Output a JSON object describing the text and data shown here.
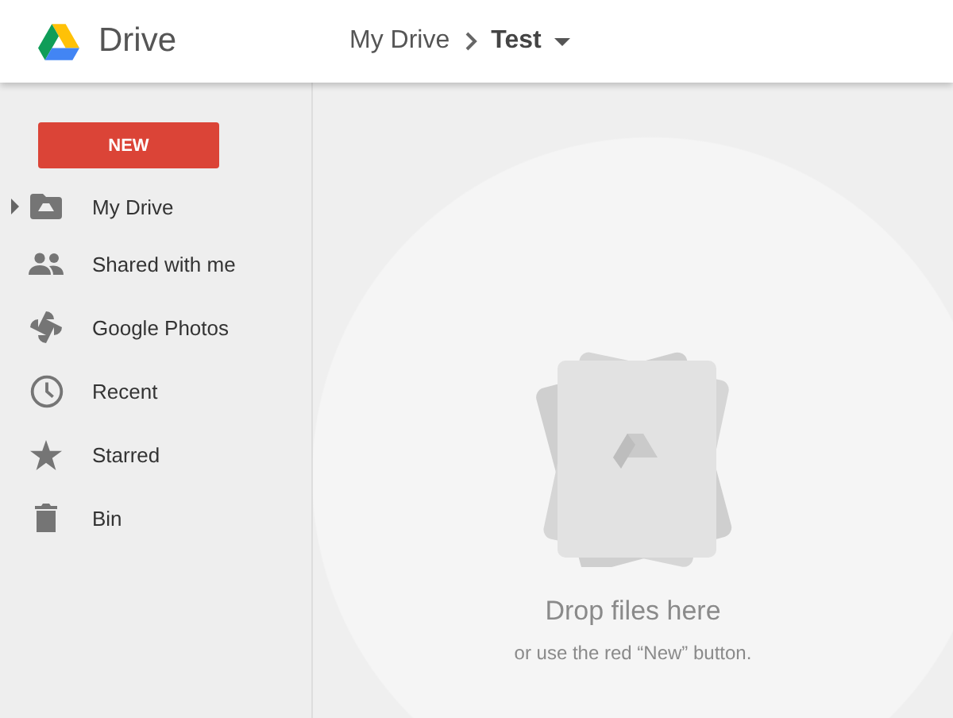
{
  "app": {
    "name": "Drive"
  },
  "breadcrumb": {
    "parent": "My Drive",
    "current": "Test"
  },
  "new_button": {
    "label": "NEW"
  },
  "sidebar": {
    "items": [
      {
        "label": "My Drive",
        "kind": "drive",
        "expanded": false
      },
      {
        "label": "Shared with me",
        "kind": "shared"
      },
      {
        "label": "Google Photos",
        "kind": "photos"
      },
      {
        "label": "Recent",
        "kind": "recent"
      },
      {
        "label": "Starred",
        "kind": "starred"
      },
      {
        "label": "Bin",
        "kind": "bin"
      }
    ]
  },
  "empty_state": {
    "title": "Drop files here",
    "hint": "or use the red “New” button."
  }
}
